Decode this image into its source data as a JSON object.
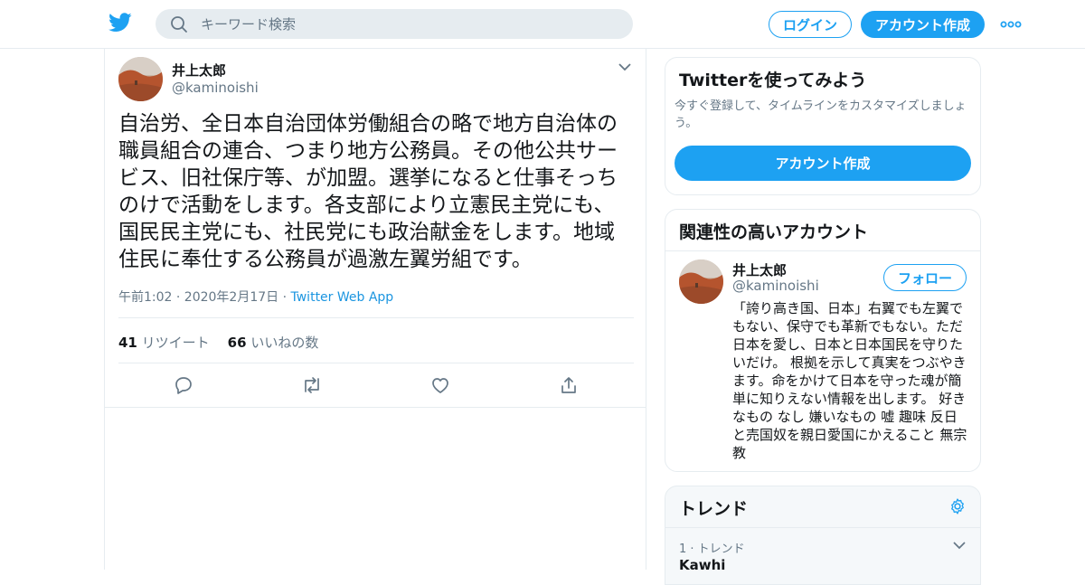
{
  "header": {
    "search_placeholder": "キーワード検索",
    "login_label": "ログイン",
    "signup_label": "アカウント作成"
  },
  "tweet": {
    "author_name": "井上太郎",
    "author_handle": "@kaminoishi",
    "text": "自治労、全日本自治団体労働組合の略で地方自治体の職員組合の連合、つまり地方公務員。その他公共サービス、旧社保庁等、が加盟。選挙になると仕事そっちのけで活動をします。各支部により立憲民主党にも、国民民主党にも、社民党にも政治献金をします。地域住民に奉仕する公務員が過激左翼労組です。",
    "time": "午前1:02 · 2020年2月17日 · ",
    "source": "Twitter Web App",
    "retweet_count": "41",
    "retweet_label": "リツイート",
    "like_count": "66",
    "like_label": "いいねの数"
  },
  "sidebar": {
    "signup_card": {
      "title": "Twitterを使ってみよう",
      "description": "今すぐ登録して、タイムラインをカスタマイズしましょう。",
      "button_label": "アカウント作成"
    },
    "relevant": {
      "title": "関連性の高いアカウント",
      "name": "井上太郎",
      "handle": "@kaminoishi",
      "follow_label": "フォロー",
      "bio": "「誇り高き国、日本」右翼でも左翼でもない、保守でも革新でもない。ただ日本を愛し、日本と日本国民を守りたいだけ。 根拠を示して真実をつぶやきます。命をかけて日本を守った魂が簡単に知りえない情報を出します。 好きなもの なし 嫌いなもの 嘘 趣味 反日と売国奴を親日愛国にかえること 無宗教"
    },
    "trends": {
      "title": "トレンド",
      "item_meta": "1 · トレンド",
      "item_name": "Kawhi"
    }
  },
  "colors": {
    "accent": "#1da1f2",
    "link": "#1b95e0",
    "muted": "#657786",
    "border": "#e6ecf0"
  },
  "icons": [
    "twitter-bird-icon",
    "search-icon",
    "more-icon",
    "chevron-down-icon",
    "reply-icon",
    "retweet-icon",
    "like-icon",
    "share-icon",
    "gear-icon"
  ]
}
